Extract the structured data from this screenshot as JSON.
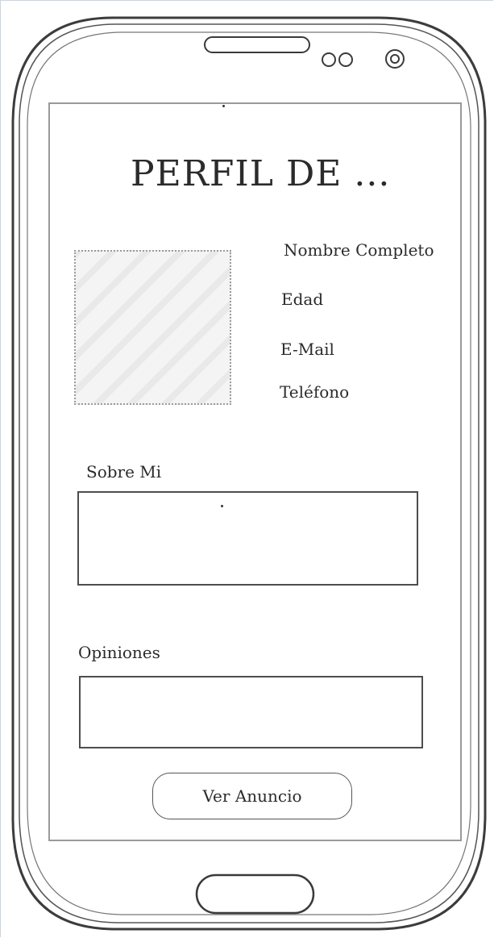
{
  "profile": {
    "title": "PERFIL DE ...",
    "fields": {
      "full_name": "Nombre Completo",
      "age": "Edad",
      "email": "E-Mail",
      "phone": "Teléfono"
    }
  },
  "about": {
    "label": "Sobre Mi",
    "value": ""
  },
  "reviews": {
    "label": "Opiniones",
    "value": ""
  },
  "actions": {
    "view_ad_label": "Ver Anuncio"
  },
  "icons": {
    "speaker": "speaker-grille-icon",
    "sensors": "sensor-dots-icon",
    "camera": "front-camera-icon",
    "home": "home-button-icon"
  }
}
